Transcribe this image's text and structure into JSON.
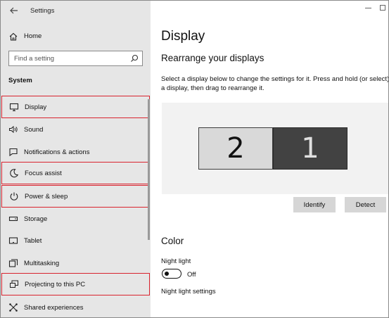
{
  "window": {
    "app_title": "Settings"
  },
  "sidebar": {
    "home_label": "Home",
    "search_placeholder": "Find a setting",
    "section_label": "System",
    "items": [
      {
        "label": "Display",
        "icon": "monitor-icon",
        "highlighted": true
      },
      {
        "label": "Sound",
        "icon": "speaker-icon",
        "highlighted": false
      },
      {
        "label": "Notifications & actions",
        "icon": "notification-icon",
        "highlighted": false
      },
      {
        "label": "Focus assist",
        "icon": "moon-icon",
        "highlighted": true
      },
      {
        "label": "Power & sleep",
        "icon": "power-icon",
        "highlighted": true
      },
      {
        "label": "Storage",
        "icon": "storage-icon",
        "highlighted": false
      },
      {
        "label": "Tablet",
        "icon": "tablet-icon",
        "highlighted": false
      },
      {
        "label": "Multitasking",
        "icon": "multitasking-icon",
        "highlighted": false
      },
      {
        "label": "Projecting to this PC",
        "icon": "projecting-icon",
        "highlighted": true
      },
      {
        "label": "Shared experiences",
        "icon": "shared-experiences-icon",
        "highlighted": false
      }
    ]
  },
  "main": {
    "page_title": "Display",
    "rearrange_heading": "Rearrange your displays",
    "rearrange_description": "Select a display below to change the settings for it. Press and hold (or select) a display, then drag to rearrange it.",
    "monitors": [
      {
        "number": "2",
        "selected": false
      },
      {
        "number": "1",
        "selected": true
      }
    ],
    "identify_button": "Identify",
    "detect_button": "Detect",
    "color_heading": "Color",
    "night_light_label": "Night light",
    "night_light_state": "Off",
    "night_light_settings_link": "Night light settings"
  },
  "colors": {
    "sidebar_bg": "#e6e6e6",
    "highlight_border": "#d9232e",
    "selected_monitor": "#424242",
    "unselected_monitor": "#d9d9d9"
  }
}
